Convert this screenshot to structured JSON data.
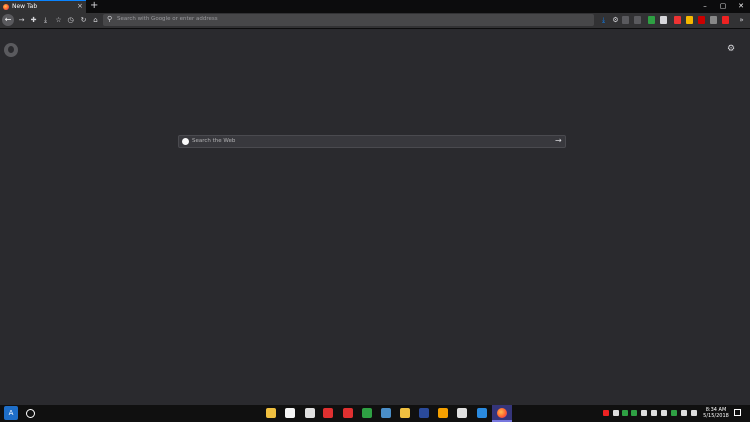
{
  "tab": {
    "title": "New Tab",
    "close": "×"
  },
  "newtab": "+",
  "window": {
    "minimize": "–",
    "maximize": "▢",
    "close": "✕"
  },
  "urlbar": {
    "placeholder": "Search with Google or enter address"
  },
  "search": {
    "placeholder": "Search the Web",
    "go": "→"
  },
  "nav_icons": [
    "back-arrow",
    "forward-arrow",
    "puzzle",
    "download",
    "star",
    "history",
    "reload",
    "home"
  ],
  "extension_colors": [
    "#0a84ff",
    "#d7d7db",
    "#5a5a5e",
    "#5a5a5e",
    "#2ea043",
    "#d7d7db",
    "#e33",
    "#f5b800",
    "#c00",
    "#888",
    "#e22",
    "#e22",
    "#e22"
  ],
  "overflow": "»",
  "menu": "☰",
  "start_label": "A",
  "taskbar_colors": [
    "#f0c040",
    "#f5f5f5",
    "#e0e0e0",
    "#e03030",
    "#2ea043",
    "#4a8ec8",
    "#f0c040",
    "#2a4a9a",
    "#f5a000",
    "#e0e0e0",
    "#2a8adf"
  ],
  "tray_colors": [
    "#e22",
    "#ddd",
    "#2ea043",
    "#2ea043",
    "#ddd",
    "#ddd",
    "#ddd",
    "#2ea043",
    "#ddd",
    "#ddd"
  ],
  "clock": {
    "time": "8:34 AM",
    "date": "5/15/2018"
  }
}
